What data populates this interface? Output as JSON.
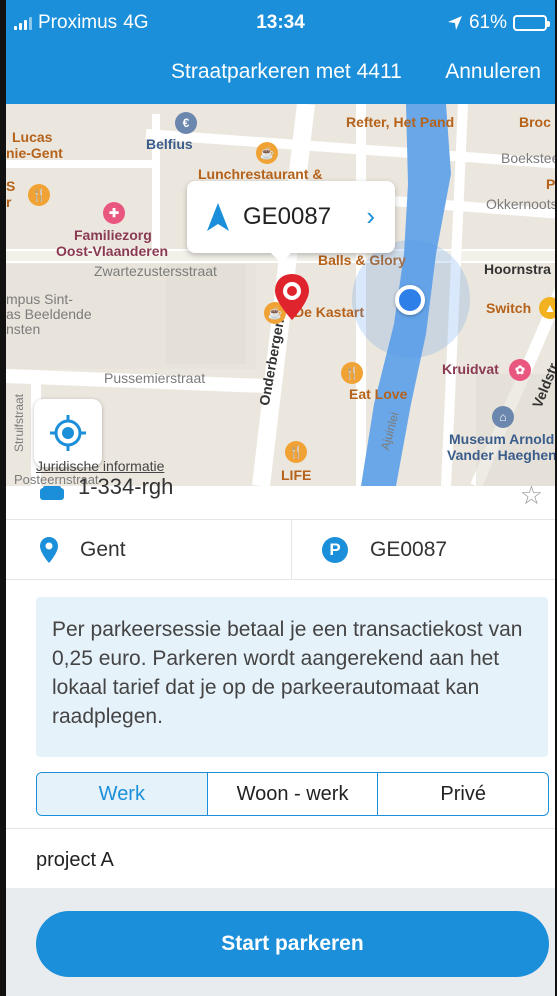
{
  "status": {
    "carrier": "Proximus",
    "network": "4G",
    "time": "13:34",
    "battery": "61%",
    "battery_fraction": 0.61,
    "location_icon": "location-arrow-icon"
  },
  "nav": {
    "title": "Straatparkeren met 4411",
    "cancel": "Annuleren"
  },
  "map": {
    "labels": {
      "lucas": "Lucas",
      "lucas2": "nie-Gent",
      "belfius": "Belfius",
      "refter": "Refter, Het Pand",
      "broc": "Broc",
      "boeksteeg": "Boekstee",
      "lunch": "Lunchrestaurant &",
      "familiezorg1": "Familiezorg",
      "familiezorg2": "Oost-Vlaanderen",
      "okkernoot": "Okkernootst",
      "zwartezusters": "Zwartezustersstraat",
      "balls": "Balls & Glory",
      "hoornstraat": "Hoornstra",
      "campus1": "mpus Sint-",
      "campus2": "as Beeldende",
      "campus3": "nsten",
      "kastart": "De Kastart",
      "switch": "Switch",
      "onderbergen": "Onderbergen",
      "kruidvat": "Kruidvat",
      "veldstraat": "Veldstr",
      "pussemier": "Pussemierstraat",
      "eatlove": "Eat Love",
      "struifstraat": "Struifstraat",
      "ajuinlei": "Ajuinlei",
      "museum1": "Museum Arnold",
      "museum2": "Vander Haeghen",
      "life": "LIFE",
      "posteernstraat": "Posteernstraat",
      "p_right": "P",
      "s_left": "S",
      "r_left": "r"
    },
    "callout": {
      "code": "GE0087",
      "nav_icon": "navigation-arrow-icon",
      "chevron_icon": "chevron-right-icon"
    },
    "legal": "Juridische informatie"
  },
  "session": {
    "plate": "1-334-rgh",
    "city": "Gent",
    "zone": "GE0087",
    "notice": "Per parkeersessie betaal je een transactiekost van 0,25 euro. Parkeren wordt aangerekend aan het lokaal tarief dat je op de parkeerautomaat kan raadplegen.",
    "segments": [
      "Werk",
      "Woon - werk",
      "Privé"
    ],
    "selected_segment": "Werk",
    "project": "project A",
    "start_button": "Start parkeren"
  },
  "colors": {
    "brand": "#1b8fd9",
    "pin": "#e0242e",
    "location_dot": "#2f7fe8"
  }
}
